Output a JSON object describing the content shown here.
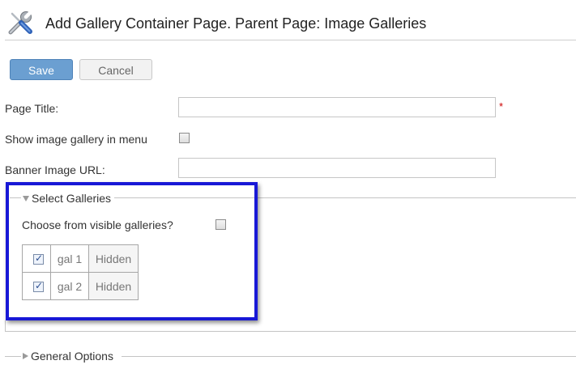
{
  "header": {
    "title": "Add Gallery Container Page. Parent Page: Image Galleries",
    "icon": "tools-icon"
  },
  "toolbar": {
    "save_label": "Save",
    "cancel_label": "Cancel"
  },
  "form": {
    "page_title_label": "Page Title:",
    "page_title_value": "",
    "required_marker": "*",
    "show_in_menu_label": "Show image gallery in menu",
    "show_in_menu_checked": false,
    "banner_url_label": "Banner Image URL:",
    "banner_url_value": ""
  },
  "select_galleries": {
    "legend": "Select Galleries",
    "expanded": true,
    "choose_visible_label": "Choose from visible galleries?",
    "choose_visible_checked": false,
    "galleries": [
      {
        "name": "gal 1",
        "status": "Hidden",
        "checked": true
      },
      {
        "name": "gal 2",
        "status": "Hidden",
        "checked": true
      }
    ]
  },
  "general_options": {
    "legend": "General Options",
    "expanded": false
  },
  "colors": {
    "save_button": "#6b9fd1",
    "highlight_border": "#1818d6",
    "required": "#cc0000"
  }
}
